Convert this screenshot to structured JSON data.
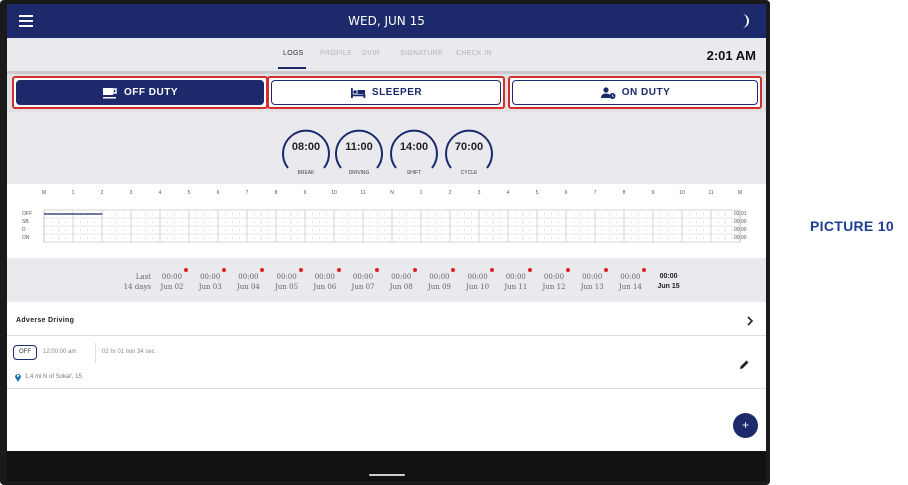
{
  "topbar": {
    "title": "WED, JUN 15",
    "menu_icon": "hamburger-menu-icon",
    "theme_icon": "moon-icon"
  },
  "tabs": [
    {
      "label": "LOGS",
      "active": true
    },
    {
      "label": "PROFILE",
      "active": false
    },
    {
      "label": "DVIR",
      "active": false
    },
    {
      "label": "SIGNATURE",
      "active": false
    },
    {
      "label": "CHECK IN",
      "active": false
    }
  ],
  "clock": "2:01 AM",
  "status": {
    "off_duty": "OFF DUTY",
    "sleeper": "SLEEPER",
    "on_duty": "ON DUTY",
    "selected": "off_duty",
    "highlight_color": "#d32f2f"
  },
  "timers": [
    {
      "value": "08:00",
      "label": "BREAK",
      "fraction": 1.0
    },
    {
      "value": "11:00",
      "label": "DRIVING",
      "fraction": 1.0
    },
    {
      "value": "14:00",
      "label": "SHIFT",
      "fraction": 1.0
    },
    {
      "value": "70:00",
      "label": "CYCLE",
      "fraction": 1.0
    }
  ],
  "graph": {
    "hours": [
      "M",
      "1",
      "2",
      "3",
      "4",
      "5",
      "6",
      "7",
      "8",
      "9",
      "10",
      "11",
      "N",
      "1",
      "2",
      "3",
      "4",
      "5",
      "6",
      "7",
      "8",
      "9",
      "10",
      "11",
      "M"
    ],
    "rows": [
      {
        "label": "OFF",
        "total": "02:01"
      },
      {
        "label": "SB",
        "total": "00:00"
      },
      {
        "label": "D",
        "total": "00:00"
      },
      {
        "label": "ON",
        "total": "00:00"
      }
    ],
    "off_duty_hours": [
      0,
      2.0167
    ]
  },
  "summary": {
    "last_line1": "Last",
    "last_line2": "14 days",
    "days": [
      {
        "value": "00:00",
        "date": "Jun 02",
        "flag": true
      },
      {
        "value": "00:00",
        "date": "Jun 03",
        "flag": true
      },
      {
        "value": "00:00",
        "date": "Jun 04",
        "flag": true
      },
      {
        "value": "00:00",
        "date": "Jun 05",
        "flag": true
      },
      {
        "value": "00:00",
        "date": "Jun 06",
        "flag": true
      },
      {
        "value": "00:00",
        "date": "Jun 07",
        "flag": true
      },
      {
        "value": "00:00",
        "date": "Jun 08",
        "flag": true
      },
      {
        "value": "00:00",
        "date": "Jun 09",
        "flag": true
      },
      {
        "value": "00:00",
        "date": "Jun 10",
        "flag": true
      },
      {
        "value": "00:00",
        "date": "Jun 11",
        "flag": true
      },
      {
        "value": "00:00",
        "date": "Jun 12",
        "flag": true
      },
      {
        "value": "00:00",
        "date": "Jun 13",
        "flag": true
      },
      {
        "value": "00:00",
        "date": "Jun 14",
        "flag": true
      },
      {
        "value": "00:00",
        "date": "Jun 15",
        "flag": false
      }
    ]
  },
  "adverse": {
    "label": "Adverse Driving"
  },
  "event": {
    "status": "OFF",
    "time": "12:00:00 am",
    "duration": "02 hr 01 min 34 sec",
    "location": "1.4 mi N of Sokal', 15"
  },
  "fab": {
    "label": "+"
  },
  "caption": "PICTURE 10",
  "colors": {
    "brand": "#1c2a6b",
    "alert": "#e02020"
  }
}
